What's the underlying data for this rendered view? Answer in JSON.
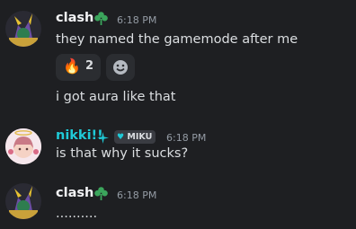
{
  "messages": [
    {
      "author": "clash",
      "time": "6:18 PM",
      "lines": [
        "they named the gamemode after me",
        "i got aura like that"
      ],
      "reaction": {
        "emoji": "🔥",
        "count": "2"
      }
    },
    {
      "author": "nikki!!",
      "time": "6:18 PM",
      "tag": "MIKU",
      "lines": [
        "is that why it sucks?"
      ]
    },
    {
      "author": "clash",
      "time": "6:18 PM",
      "lines": [
        ".........."
      ]
    }
  ],
  "colors": {
    "background": "#1e1f22",
    "nikki_name": "#1fcad7",
    "clover": "#3ba55c",
    "reaction_bg": "#2b2d31"
  },
  "icons": [
    "clover-icon",
    "fire-emoji",
    "add-reaction-icon",
    "sparkle-icon",
    "heart-icon"
  ]
}
